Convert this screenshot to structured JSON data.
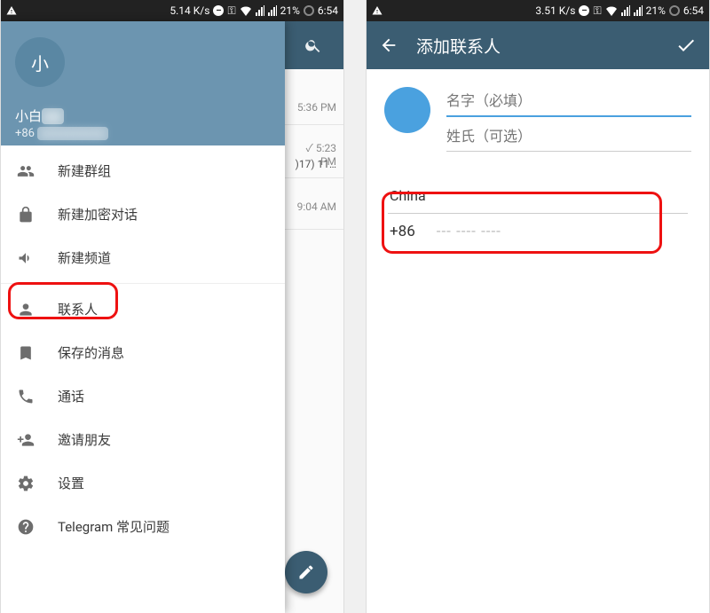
{
  "status_bar": {
    "net_speed_left": "5.14 K/s",
    "net_speed_right": "3.51 K/s",
    "battery": "21%",
    "time": "6:54"
  },
  "left_phone": {
    "drawer": {
      "avatar_initial": "小",
      "username": "小白",
      "phone_prefix": "+86",
      "items": [
        {
          "icon": "group-icon",
          "label": "新建群组"
        },
        {
          "icon": "lock-icon",
          "label": "新建加密对话"
        },
        {
          "icon": "megaphone-icon",
          "label": "新建频道"
        },
        {
          "icon": "person-icon",
          "label": "联系人"
        },
        {
          "icon": "bookmark-icon",
          "label": "保存的消息"
        },
        {
          "icon": "phone-icon",
          "label": "通话"
        },
        {
          "icon": "invite-icon",
          "label": "邀请朋友"
        },
        {
          "icon": "gear-icon",
          "label": "设置"
        },
        {
          "icon": "help-icon",
          "label": "Telegram 常见问题"
        }
      ]
    },
    "chat_preview": {
      "times": [
        "5:36 PM",
        "5:23 PM",
        "9:04 AM"
      ],
      "snippet": ")17) 11…",
      "check": "✓"
    }
  },
  "right_phone": {
    "toolbar": {
      "title": "添加联系人"
    },
    "form": {
      "first_name_placeholder": "名字（必填）",
      "last_name_placeholder": "姓氏（可选）",
      "country": "China",
      "country_code": "+86",
      "phone_placeholder": "--- ---- ----"
    }
  }
}
